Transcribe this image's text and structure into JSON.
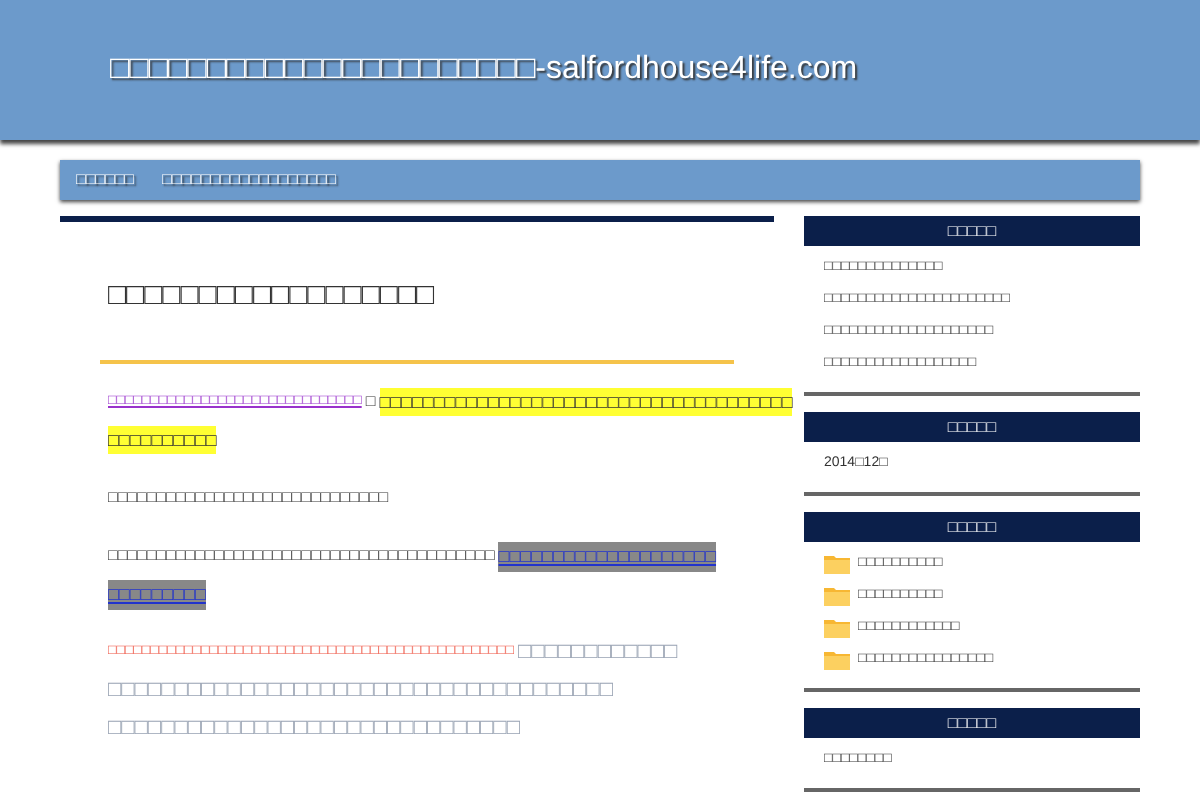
{
  "site_title": "□□□□□□□□□□□□□□□□□□□□□□-salfordhouse4life.com",
  "nav": [
    {
      "label": "□□□□□□"
    },
    {
      "label": "□□□□□□□□□□□□□□□□□□"
    }
  ],
  "post": {
    "title": "□□□□□□□□□□□□□□□□□□",
    "paragraphs": [
      {
        "lines": [
          [
            {
              "kind": "link",
              "text": "□□□□□□□□□□□□□□□□□□□□□□□□□□□□□□"
            },
            {
              "kind": "plain",
              "text": " □"
            },
            {
              "kind": "highlight",
              "text": "□□□□□□□□□□□□□□□□□□□□□□□□□□□□□□□□□□□□□□"
            }
          ],
          [
            {
              "kind": "highlight",
              "text": "□□□□□□□□□□"
            }
          ]
        ]
      },
      {
        "lines": [
          [
            {
              "kind": "plain",
              "text": "□□□□□□□□□□□□□□□□□□□□□□□□□□□□□"
            }
          ]
        ]
      },
      {
        "lines": [
          [
            {
              "kind": "plain",
              "text": "□□□□□□□□□□□□□□□□□□□□□□□□□□□□□□□□□□□□□□□□"
            },
            {
              "kind": "boxed_link",
              "text": "□□□□□□□□□□□□□□□□□□□□"
            }
          ],
          [
            {
              "kind": "boxed_link",
              "text": "□□□□□□□□□"
            }
          ]
        ]
      },
      {
        "lines": [
          [
            {
              "kind": "red",
              "text": "□□□□□□□□□□□□□□□□□□□□□□□□□□□□□□□□□□□□□□□□□□□□□□□□"
            },
            {
              "kind": "large",
              "text": "□□□□□□□□□□□□"
            }
          ],
          [
            {
              "kind": "large",
              "text": "□□□□□□□□□□□□□□□□□□□□□□□□□□□□□□□□□□□□□□"
            }
          ],
          [
            {
              "kind": "large",
              "text": "□□□□□□□□□□□□□□□□□□□□□□□□□□□□□□□"
            }
          ]
        ]
      }
    ]
  },
  "sidebar": [
    {
      "heading": "□□□□□",
      "kind": "links",
      "items": [
        "□□□□□□□□□□□□□□",
        "□□□□□□□□□□□□□□□□□□□□□□",
        "□□□□□□□□□□□□□□□□□□□□",
        "□□□□□□□□□□□□□□□□□□"
      ]
    },
    {
      "heading": "□□□□□",
      "kind": "links",
      "items": [
        "2014□12□"
      ]
    },
    {
      "heading": "□□□□□",
      "kind": "folders",
      "items": [
        "□□□□□□□□□□",
        "□□□□□□□□□□",
        "□□□□□□□□□□□□",
        "□□□□□□□□□□□□□□□□"
      ]
    },
    {
      "heading": "□□□□□",
      "kind": "links",
      "items": [
        "□□□□□□□□"
      ]
    }
  ]
}
